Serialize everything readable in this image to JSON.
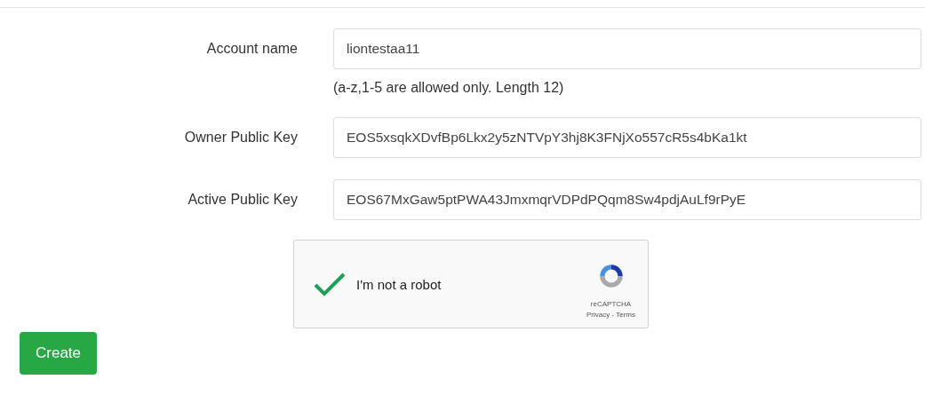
{
  "fields": [
    {
      "label": "Account name",
      "value": "liontestaa11",
      "hint": "(a-z,1-5 are allowed only. Length 12)"
    },
    {
      "label": "Owner Public Key",
      "value": "EOS5xsqkXDvfBp6Lkx2y5zNTVpY3hj8K3FNjXo557cR5s4bKa1kt"
    },
    {
      "label": "Active Public Key",
      "value": "EOS67MxGaw5ptPWA43JmxmqrVDPdPQqm8Sw4pdjAuLf9rPyE"
    }
  ],
  "captcha": {
    "label": "I'm not a robot",
    "checked": true,
    "brand": "reCAPTCHA",
    "links": "Privacy - Terms"
  },
  "buttons": [
    "Create"
  ]
}
